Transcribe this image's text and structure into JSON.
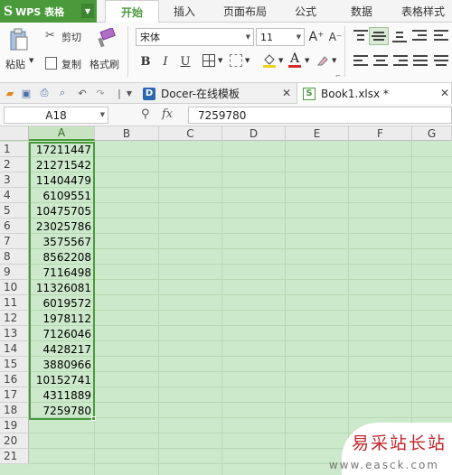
{
  "app": {
    "logo_letter": "S",
    "name": "WPS 表格",
    "menu_arrow": "▼"
  },
  "menu": {
    "tabs": [
      "开始",
      "插入",
      "页面布局",
      "公式",
      "数据",
      "表格样式"
    ],
    "active": "开始"
  },
  "ribbon": {
    "paste_label": "粘贴",
    "cut_label": "剪切",
    "copy_label": "复制",
    "format_painter_label": "格式刷",
    "font_name": "宋体",
    "font_size": "11",
    "grow_font": "A⁺",
    "shrink_font": "A⁻",
    "bold": "B",
    "italic": "I",
    "underline": "U"
  },
  "tabs": {
    "docer_label": "Docer-在线模板",
    "workbook_label": "Book1.xlsx *",
    "close_glyph": "✕"
  },
  "formula": {
    "cell_ref": "A18",
    "fx": "fx",
    "value": "7259780"
  },
  "sheet": {
    "columns": [
      "A",
      "B",
      "C",
      "D",
      "E",
      "F",
      "G"
    ],
    "rows": [
      "1",
      "2",
      "3",
      "4",
      "5",
      "6",
      "7",
      "8",
      "9",
      "10",
      "11",
      "12",
      "13",
      "14",
      "15",
      "16",
      "17",
      "18",
      "19",
      "20",
      "21"
    ],
    "column_a": [
      "17211447",
      "21271542",
      "11404479",
      "6109551",
      "10475705",
      "23025786",
      "3575567",
      "8562208",
      "7116498",
      "11326081",
      "6019572",
      "1978112",
      "7126046",
      "4428217",
      "3880966",
      "10152741",
      "4311889",
      "7259780"
    ],
    "selected_range": "A1:A18"
  },
  "watermark": {
    "title": "易采站长站",
    "site": "www.easck.com"
  },
  "colors": {
    "accent": "#4a9a3c",
    "grid_fill": "#cde9cb",
    "watermark_red": "#c0262b"
  }
}
